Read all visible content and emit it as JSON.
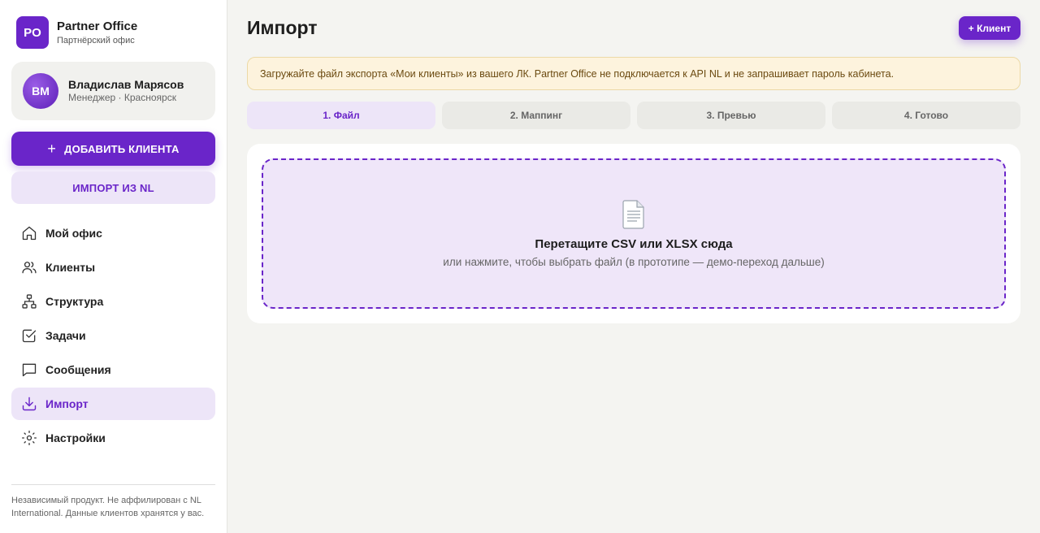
{
  "brand": {
    "logo": "PO",
    "name": "Partner Office",
    "subtitle": "Партнёрский офис"
  },
  "user": {
    "initials": "ВМ",
    "name": "Владислав Марясов",
    "role": "Менеджер · Красноярск"
  },
  "sidebar": {
    "add_client_label": "ДОБАВИТЬ КЛИЕНТА",
    "import_label": "ИМПОРТ ИЗ NL",
    "nav": [
      {
        "label": "Мой офис",
        "icon": "home-icon"
      },
      {
        "label": "Клиенты",
        "icon": "users-icon"
      },
      {
        "label": "Структура",
        "icon": "structure-icon"
      },
      {
        "label": "Задачи",
        "icon": "checkbox-icon"
      },
      {
        "label": "Сообщения",
        "icon": "message-icon"
      },
      {
        "label": "Импорт",
        "icon": "download-icon",
        "active": true
      },
      {
        "label": "Настройки",
        "icon": "gear-icon"
      }
    ],
    "disclaimer": "Независимый продукт. Не аффилирован с NL International. Данные клиентов хранятся у вас."
  },
  "main": {
    "title": "Импорт",
    "client_button": "+ Клиент",
    "notice": "Загружайте файл экспорта «Мои клиенты» из вашего ЛК. Partner Office не подключается к API NL и не запрашивает пароль кабинета.",
    "steps": [
      {
        "label": "1. Файл",
        "active": true
      },
      {
        "label": "2. Маппинг"
      },
      {
        "label": "3. Превью"
      },
      {
        "label": "4. Готово"
      }
    ],
    "dropzone": {
      "icon": "document-icon",
      "title": "Перетащите CSV или XLSX сюда",
      "subtitle": "или нажмите, чтобы выбрать файл (в прототипе — демо-переход дальше)"
    }
  },
  "colors": {
    "accent": "#6a25c9",
    "accent_soft": "#ede5f8",
    "notice_bg": "#fdf3dd"
  }
}
